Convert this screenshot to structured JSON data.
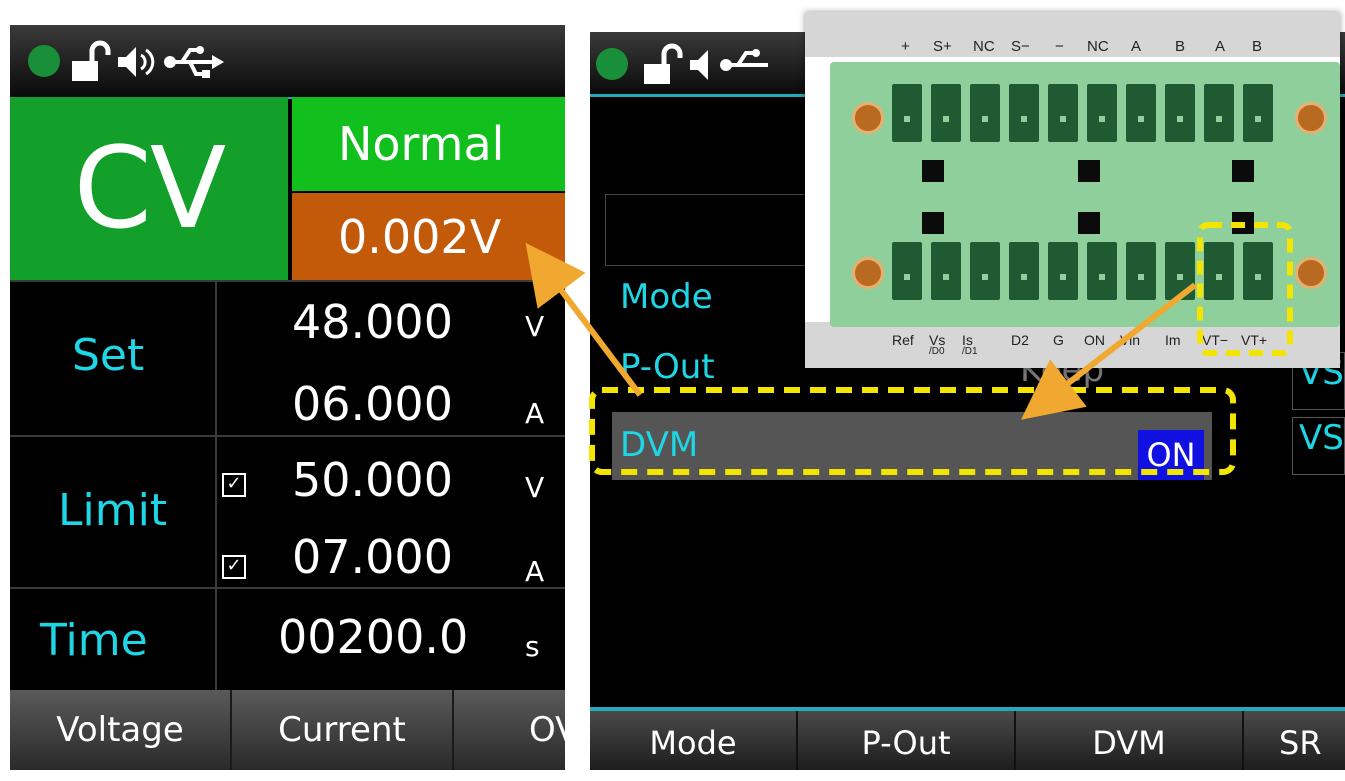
{
  "left_screen": {
    "mode": "CV",
    "status": "Normal",
    "measured_voltage": "0.002V",
    "rows": {
      "set": {
        "label": "Set",
        "voltage": "48.000",
        "voltage_unit": "V",
        "current": "06.000",
        "current_unit": "A"
      },
      "limit": {
        "label": "Limit",
        "voltage": "50.000",
        "voltage_unit": "V",
        "current": "07.000",
        "current_unit": "A",
        "voltage_checked": true,
        "current_checked": true
      },
      "time": {
        "label": "Time",
        "value": "00200.0",
        "unit": "s"
      }
    },
    "softkeys": [
      "Voltage",
      "Current",
      "OV"
    ]
  },
  "right_screen": {
    "menu": {
      "mode": "Mode",
      "p_out": "P-Out",
      "dvm": "DVM",
      "dvm_value": "ON",
      "faded_value": "Keep"
    },
    "side_tabs": [
      "VS",
      "VS"
    ],
    "softkeys": [
      "Mode",
      "P-Out",
      "DVM",
      "SR"
    ]
  },
  "connector": {
    "top_labels": [
      "+",
      "S+",
      "NC",
      "S−",
      "−",
      "NC",
      "A",
      "B",
      "A",
      "B"
    ],
    "bottom_labels": [
      "Ref",
      "Vs",
      "Is",
      "D2",
      "G",
      "ON",
      "Vin",
      "Im",
      "VT−",
      "VT+"
    ],
    "bottom_sublabels": [
      "/D0",
      "/D1"
    ]
  },
  "icons": [
    "status-dot-icon",
    "unlock-icon",
    "speaker-icon",
    "usb-icon"
  ],
  "colors": {
    "accent_cyan": "#1ed6e6",
    "cv_green": "#13a02a",
    "normal_green": "#11c01c",
    "volt_orange": "#c25a0a",
    "on_blue": "#1010e0",
    "highlight_yellow": "#f2e600",
    "arrow_orange": "#f0a830"
  }
}
